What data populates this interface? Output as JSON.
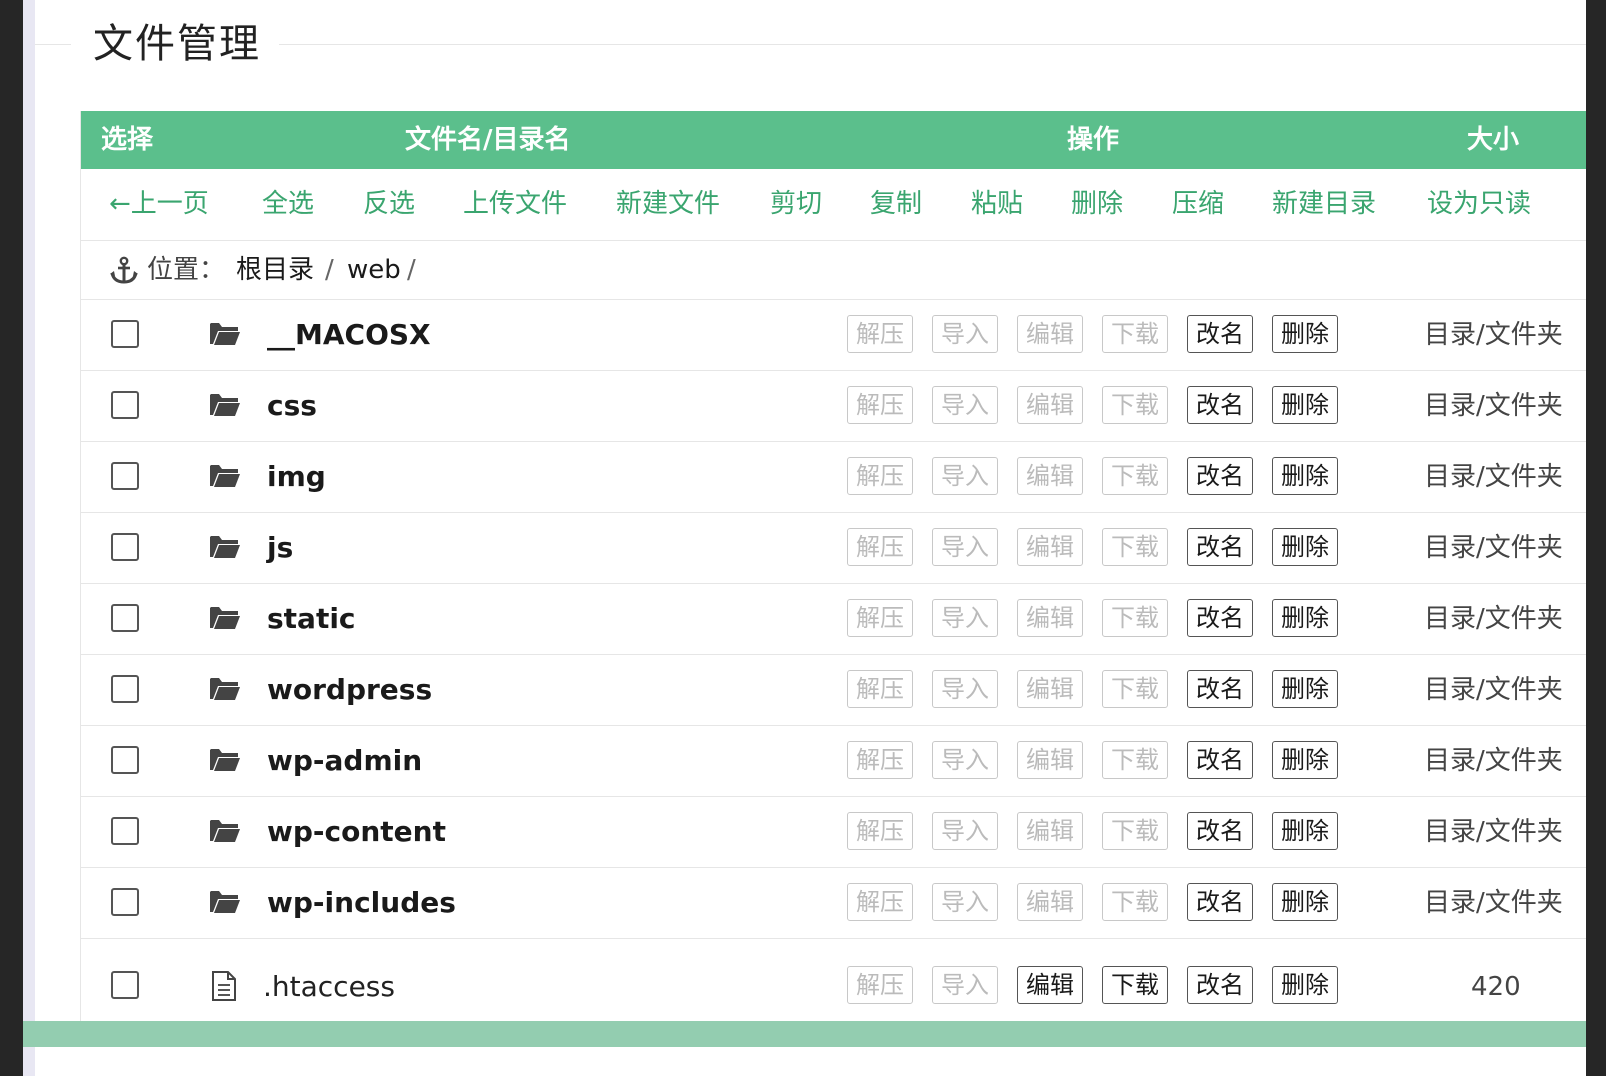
{
  "section": {
    "title": "文件管理"
  },
  "header": {
    "select": "选择",
    "name": "文件名/目录名",
    "ops": "操作",
    "size": "大小"
  },
  "toolbar": {
    "items": [
      "←上一页",
      "全选",
      "反选",
      "上传文件",
      "新建文件",
      "剪切",
      "复制",
      "粘贴",
      "删除",
      "压缩",
      "新建目录",
      "设为只读"
    ]
  },
  "location": {
    "icon": "anchor-icon",
    "label": "位置：",
    "root": "根目录",
    "sep1": "/",
    "dir": "web",
    "sep2": "/"
  },
  "op_labels": [
    "解压",
    "导入",
    "编辑",
    "下载",
    "改名",
    "删除"
  ],
  "rows": [
    {
      "name": "__MACOSX",
      "type": "folder",
      "size": "目录/文件夹"
    },
    {
      "name": "css",
      "type": "folder",
      "size": "目录/文件夹"
    },
    {
      "name": "img",
      "type": "folder",
      "size": "目录/文件夹"
    },
    {
      "name": "js",
      "type": "folder",
      "size": "目录/文件夹"
    },
    {
      "name": "static",
      "type": "folder",
      "size": "目录/文件夹"
    },
    {
      "name": "wordpress",
      "type": "folder",
      "size": "目录/文件夹"
    },
    {
      "name": "wp-admin",
      "type": "folder",
      "size": "目录/文件夹"
    },
    {
      "name": "wp-content",
      "type": "folder",
      "size": "目录/文件夹"
    },
    {
      "name": "wp-includes",
      "type": "folder",
      "size": "目录/文件夹"
    },
    {
      "name": ".htaccess",
      "type": "file",
      "size": "420"
    }
  ],
  "colors": {
    "accent": "#5bbf8c",
    "toolbar_text": "#3aa56f",
    "footer": "#93cdb0"
  }
}
